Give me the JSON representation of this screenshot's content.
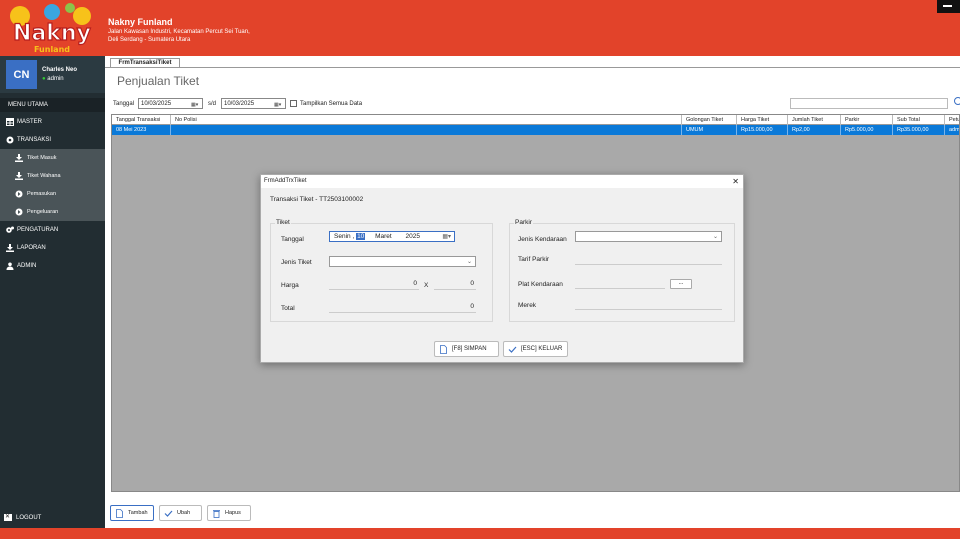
{
  "brand": {
    "name": "Nakny Funland",
    "address_line1": "Jalan Kawasan Industri, Kecamatan Percut Sei Tuan,",
    "address_line2": "Deli Serdang - Sumatera Utara",
    "logo_text": "Nakny",
    "logo_subtext": "Funland"
  },
  "user": {
    "initials": "CN",
    "name": "Charles Neo",
    "role": "admin"
  },
  "sidebar": {
    "menu_header": "MENU UTAMA",
    "items": [
      {
        "label": "MASTER",
        "icon": "table-icon"
      },
      {
        "label": "TRANSAKSI",
        "icon": "gear-icon"
      }
    ],
    "sub_items": [
      {
        "label": "Tiket Masuk",
        "icon": "download-icon"
      },
      {
        "label": "Tiket Wahana",
        "icon": "download-icon"
      },
      {
        "label": "Pemasukan",
        "icon": "circle-arrow-icon"
      },
      {
        "label": "Pengeluaran",
        "icon": "circle-arrow-icon"
      }
    ],
    "items_bottom": [
      {
        "label": "PENGATURAN",
        "icon": "gears-icon"
      },
      {
        "label": "LAPORAN",
        "icon": "download-icon"
      },
      {
        "label": "ADMIN",
        "icon": "users-icon"
      }
    ],
    "logout": "LOGOUT"
  },
  "main": {
    "tab": "FrmTransaksiTiket",
    "title": "Penjualan Tiket",
    "filter": {
      "tanggal_label": "Tanggal",
      "date_from": "10/03/2025",
      "sd_label": "s/d",
      "date_to": "10/03/2025",
      "show_all_label": "Tampilkan Semua Data"
    },
    "grid": {
      "columns": [
        "Tanggal Transaksi",
        "No Polisi",
        "Golongan Tiket",
        "Harga Tiket",
        "Jumlah Tiket",
        "Parkir",
        "Sub Total",
        "Petug"
      ],
      "rows": [
        [
          "08 Mei 2023",
          "",
          "UMUM",
          "Rp15.000,00",
          "Rp2,00",
          "Rp5.000,00",
          "Rp35.000,00",
          "admin"
        ]
      ]
    },
    "buttons": {
      "add": "Tambah",
      "edit": "Ubah",
      "delete": "Hapus"
    }
  },
  "dialog": {
    "window_title": "FrmAddTrxTiket",
    "heading": "Transaksi Tiket - TT2503100002",
    "tiket_group": "Tiket",
    "tanggal_label": "Tanggal",
    "tanggal_day": "Senin",
    "tanggal_date": "10",
    "tanggal_month": "Maret",
    "tanggal_year": "2025",
    "jenis_tiket_label": "Jenis Tiket",
    "jenis_tiket_value": "",
    "harga_label": "Harga",
    "harga_value": "0",
    "x_label": "X",
    "qty_value": "0",
    "total_label": "Total",
    "total_value": "0",
    "parkir_group": "Parkir",
    "jenis_kendaraan_label": "Jenis Kendaraan",
    "tarif_parkir_label": "Tarif Parkir",
    "plat_label": "Plat Kendaraan",
    "plat_button": "...",
    "merek_label": "Merek",
    "save_button": "[F8] SIMPAN",
    "exit_button": "[ESC] KELUAR"
  },
  "colors": {
    "brand_red": "#e2432a",
    "sidebar_dark": "#222d32",
    "selection_blue": "#0a79d8"
  }
}
